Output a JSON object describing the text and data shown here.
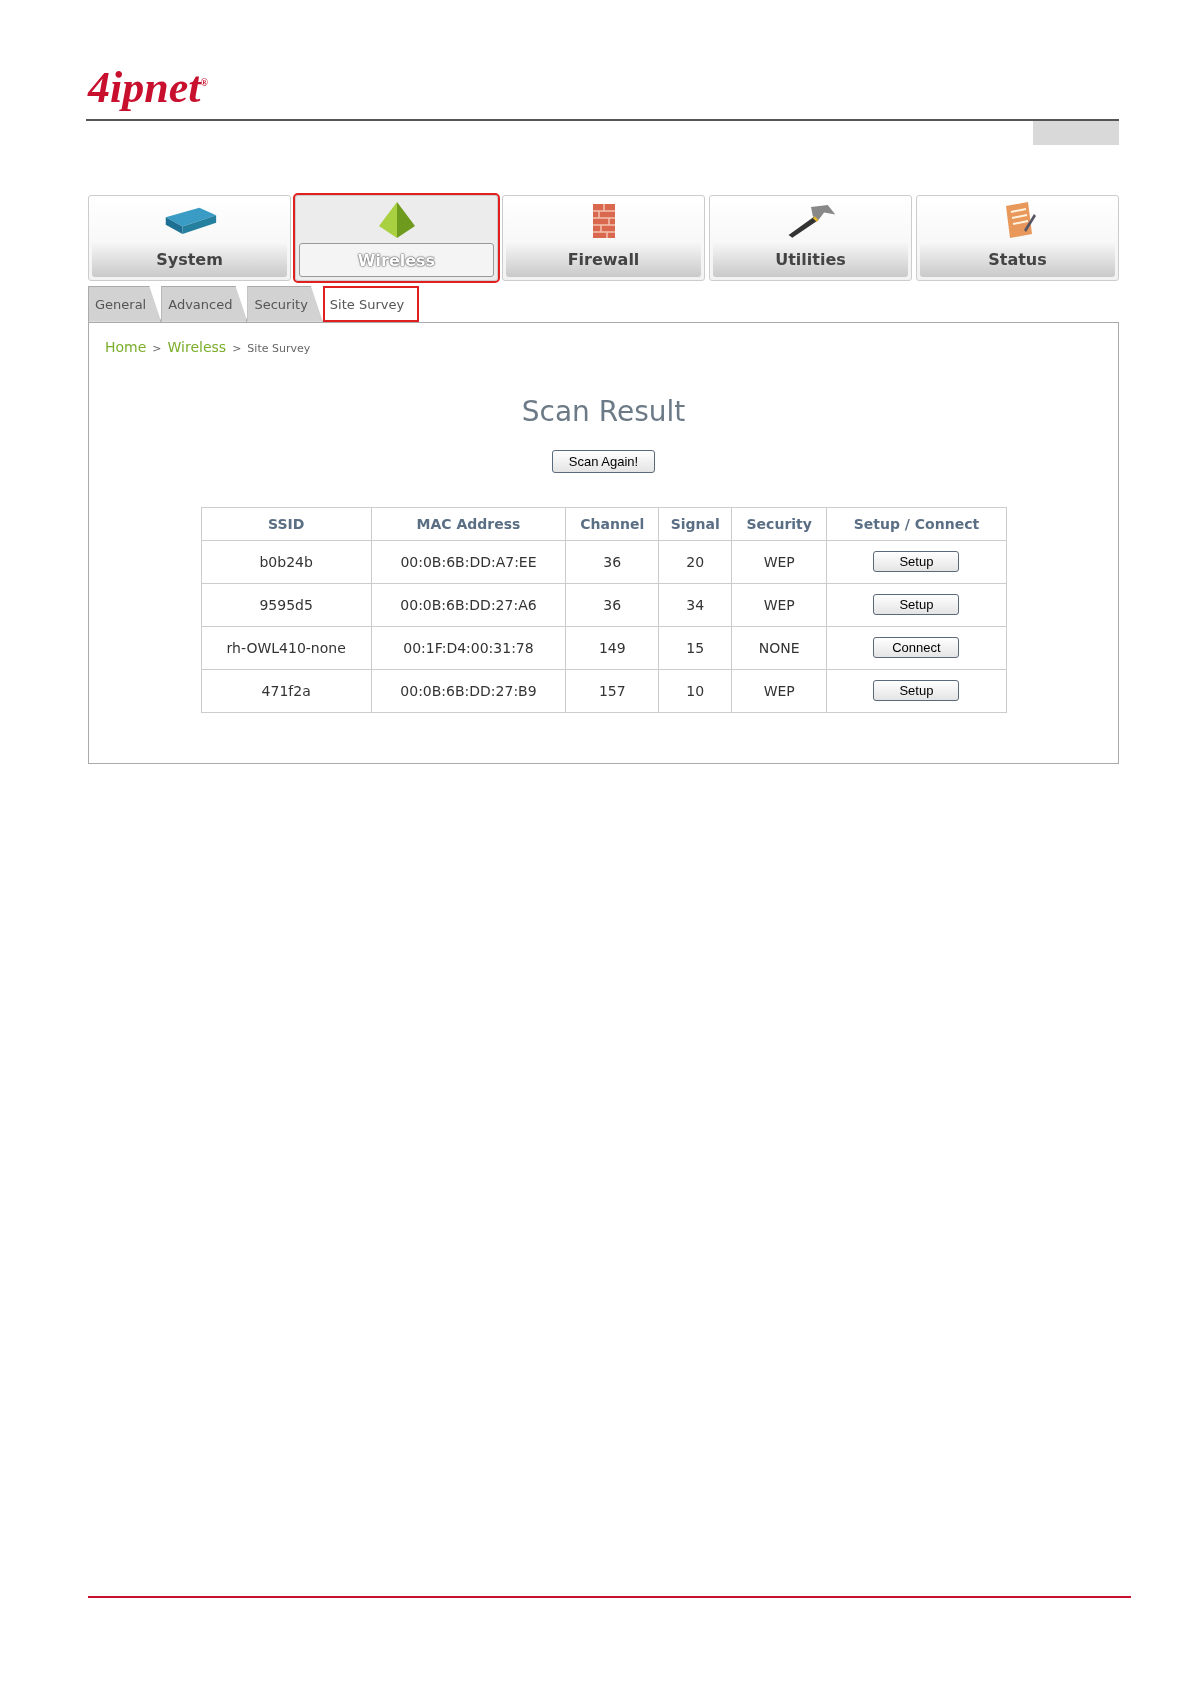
{
  "logo": "4ipnet",
  "logo_mark": "®",
  "main_menu": [
    {
      "label": "System",
      "selected": false
    },
    {
      "label": "Wireless",
      "selected": true
    },
    {
      "label": "Firewall",
      "selected": false
    },
    {
      "label": "Utilities",
      "selected": false
    },
    {
      "label": "Status",
      "selected": false
    }
  ],
  "tabs": [
    {
      "label": "General",
      "selected": false
    },
    {
      "label": "Advanced",
      "selected": false
    },
    {
      "label": "Security",
      "selected": false
    },
    {
      "label": "Site Survey",
      "selected": true
    }
  ],
  "breadcrumb": [
    {
      "label": "Home",
      "link": true
    },
    {
      "separator": ">",
      "label": "Wireless",
      "link": true
    },
    {
      "separator": ">",
      "label": "Site Survey",
      "link": false
    }
  ],
  "title": "Scan Result",
  "scan_button": "Scan Again!",
  "table": {
    "columns": [
      "SSID",
      "MAC Address",
      "Channel",
      "Signal",
      "Security",
      "Setup / Connect"
    ],
    "rows": [
      {
        "ssid": "b0b24b",
        "mac": "00:0B:6B:DD:A7:EE",
        "channel": "36",
        "signal": "20",
        "security": "WEP",
        "action": "Setup"
      },
      {
        "ssid": "9595d5",
        "mac": "00:0B:6B:DD:27:A6",
        "channel": "36",
        "signal": "34",
        "security": "WEP",
        "action": "Setup"
      },
      {
        "ssid": "rh-OWL410-none",
        "mac": "00:1F:D4:00:31:78",
        "channel": "149",
        "signal": "15",
        "security": "NONE",
        "action": "Connect"
      },
      {
        "ssid": "471f2a",
        "mac": "00:0B:6B:DD:27:B9",
        "channel": "157",
        "signal": "10",
        "security": "WEP",
        "action": "Setup"
      }
    ]
  }
}
